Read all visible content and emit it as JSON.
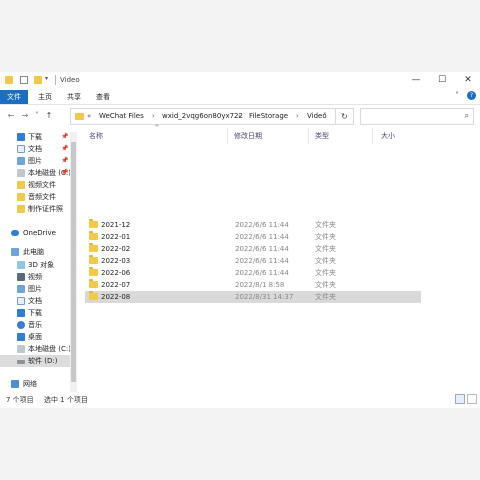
{
  "window": {
    "title": "Video",
    "controls": {
      "minimize": "—",
      "maximize": "☐",
      "close": "✕"
    }
  },
  "ribbon": {
    "tabs": [
      "文件",
      "主页",
      "共享",
      "查看"
    ],
    "expand_icon": "˅",
    "help_icon": "?"
  },
  "address": {
    "back": "←",
    "forward": "→",
    "recent": "˅",
    "up": "↑",
    "overflow": "«",
    "crumbs": [
      "WeChat Files",
      "wxid_2vqg6on80yx722",
      "FileStorage",
      "Video"
    ],
    "separator": "›",
    "dropdown": "˅",
    "refresh": "↻"
  },
  "search": {
    "icon": "search-icon",
    "glyph": "⌕"
  },
  "sidebar": {
    "items": [
      {
        "label": "下载",
        "pinned": true,
        "icon": "download-icon"
      },
      {
        "label": "文档",
        "pinned": true,
        "icon": "document-icon"
      },
      {
        "label": "图片",
        "pinned": true,
        "icon": "picture-icon"
      },
      {
        "label": "本地磁盘 (C:)",
        "pinned": true,
        "icon": "drive-icon"
      },
      {
        "label": "视频文件",
        "pinned": false,
        "icon": "folder-icon"
      },
      {
        "label": "音频文件",
        "pinned": false,
        "icon": "folder-icon"
      },
      {
        "label": "制作证件照",
        "pinned": false,
        "icon": "folder-icon"
      },
      {
        "label": "OneDrive",
        "pinned": false,
        "icon": "cloud-icon"
      },
      {
        "label": "此电脑",
        "pinned": false,
        "icon": "computer-icon"
      },
      {
        "label": "3D 对象",
        "pinned": false,
        "icon": "cube-icon"
      },
      {
        "label": "视频",
        "pinned": false,
        "icon": "video-icon"
      },
      {
        "label": "图片",
        "pinned": false,
        "icon": "picture-icon"
      },
      {
        "label": "文档",
        "pinned": false,
        "icon": "document-icon"
      },
      {
        "label": "下载",
        "pinned": false,
        "icon": "download-icon"
      },
      {
        "label": "音乐",
        "pinned": false,
        "icon": "music-icon"
      },
      {
        "label": "桌面",
        "pinned": false,
        "icon": "desktop-icon"
      },
      {
        "label": "本地磁盘 (C:)",
        "pinned": false,
        "icon": "drive-icon"
      },
      {
        "label": "软件 (D:)",
        "pinned": false,
        "icon": "drive-icon",
        "selected": true
      },
      {
        "label": "网络",
        "pinned": false,
        "icon": "network-icon"
      }
    ],
    "pin_glyph": "📌"
  },
  "columns": {
    "name": "名称",
    "date": "修改日期",
    "type": "类型",
    "size": "大小",
    "sort_glyph": "^"
  },
  "files": [
    {
      "name": "2021-12",
      "date": "2022/6/6 11:44",
      "type": "文件夹"
    },
    {
      "name": "2022-01",
      "date": "2022/6/6 11:44",
      "type": "文件夹"
    },
    {
      "name": "2022-02",
      "date": "2022/6/6 11:44",
      "type": "文件夹"
    },
    {
      "name": "2022-03",
      "date": "2022/6/6 11:44",
      "type": "文件夹"
    },
    {
      "name": "2022-06",
      "date": "2022/6/6 11:44",
      "type": "文件夹"
    },
    {
      "name": "2022-07",
      "date": "2022/8/1 8:58",
      "type": "文件夹"
    },
    {
      "name": "2022-08",
      "date": "2022/8/31 14:37",
      "type": "文件夹",
      "selected": true
    }
  ],
  "status": {
    "count": "7 个项目",
    "selection": "选中 1 个项目"
  },
  "colors": {
    "accent": "#1a6fc4",
    "folder": "#f3c94b",
    "selected_row": "#d9d9d9"
  }
}
